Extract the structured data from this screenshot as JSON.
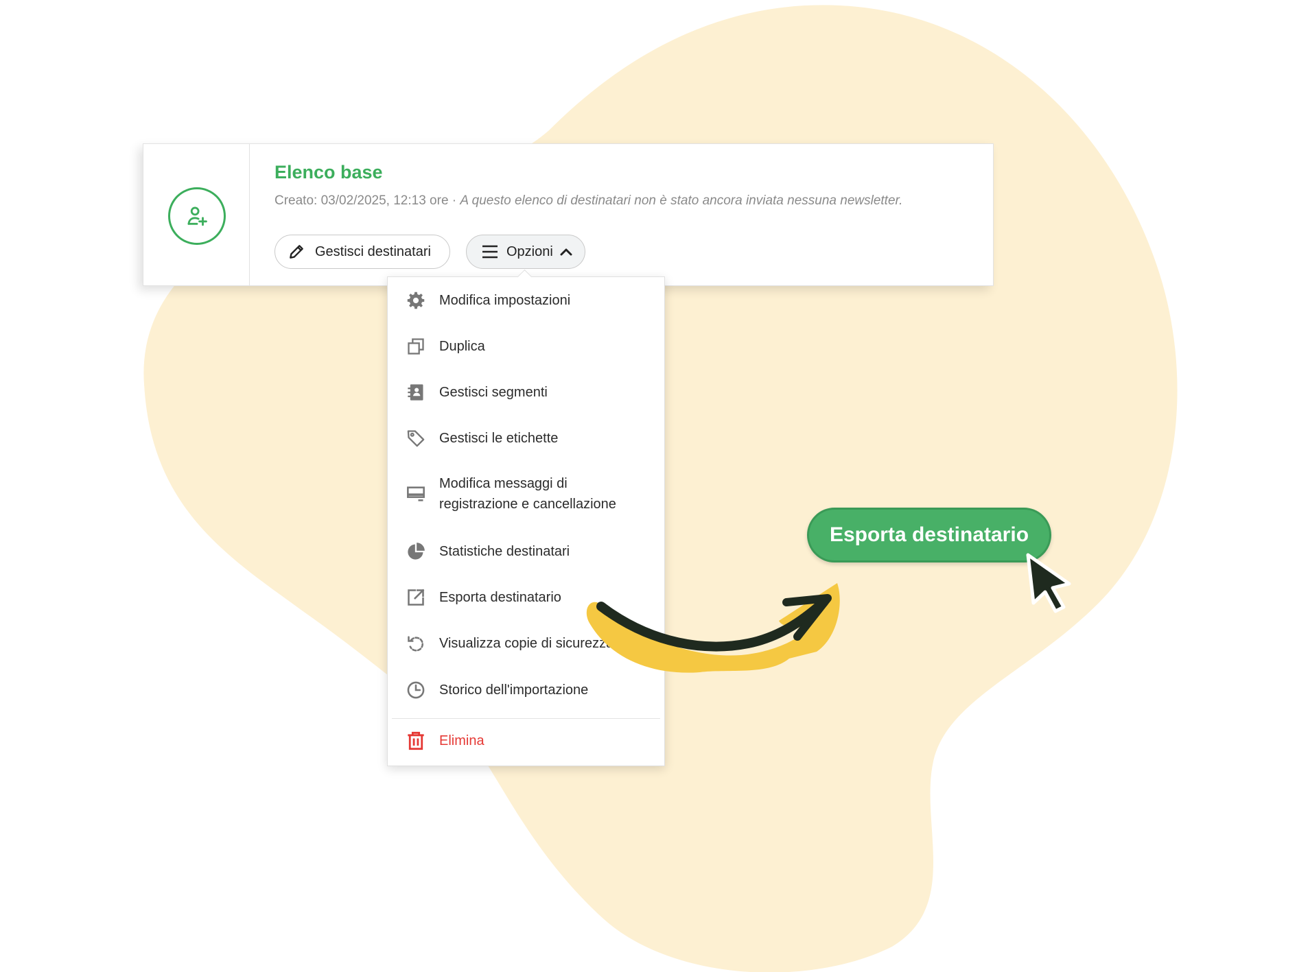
{
  "card": {
    "title": "Elenco base",
    "meta_created": "Creato: 03/02/2025, 12:13 ore",
    "meta_separator": " · ",
    "meta_note": "A questo elenco di destinatari non è stato ancora inviata nessuna newsletter."
  },
  "actions": {
    "manage_label": "Gestisci destinatari",
    "options_label": "Opzioni"
  },
  "menu": {
    "items": [
      {
        "label": "Modifica impostazioni",
        "icon": "gear-icon"
      },
      {
        "label": "Duplica",
        "icon": "duplicate-icon"
      },
      {
        "label": "Gestisci segmenti",
        "icon": "contact-book-icon"
      },
      {
        "label": "Gestisci le etichette",
        "icon": "tag-icon"
      },
      {
        "label": "Modifica messaggi di",
        "label_line2": "registrazione e cancellazione",
        "icon": "monitor-icon"
      },
      {
        "label": "Statistiche destinatari",
        "icon": "pie-chart-icon"
      },
      {
        "label": "Esporta destinatario",
        "icon": "export-icon"
      },
      {
        "label": "Visualizza copie di sicurezza",
        "icon": "restore-icon"
      },
      {
        "label": "Storico dell'importazione",
        "icon": "clock-icon"
      }
    ],
    "delete_label": "Elimina"
  },
  "highlight": {
    "label": "Esporta destinatario"
  },
  "colors": {
    "accent": "#3cae5c",
    "highlight_button": "#48b067",
    "danger": "#e53935",
    "blob": "#fdf0d2",
    "arrow_fill": "#f5c842",
    "arrow_stroke": "#1f2a1f"
  }
}
